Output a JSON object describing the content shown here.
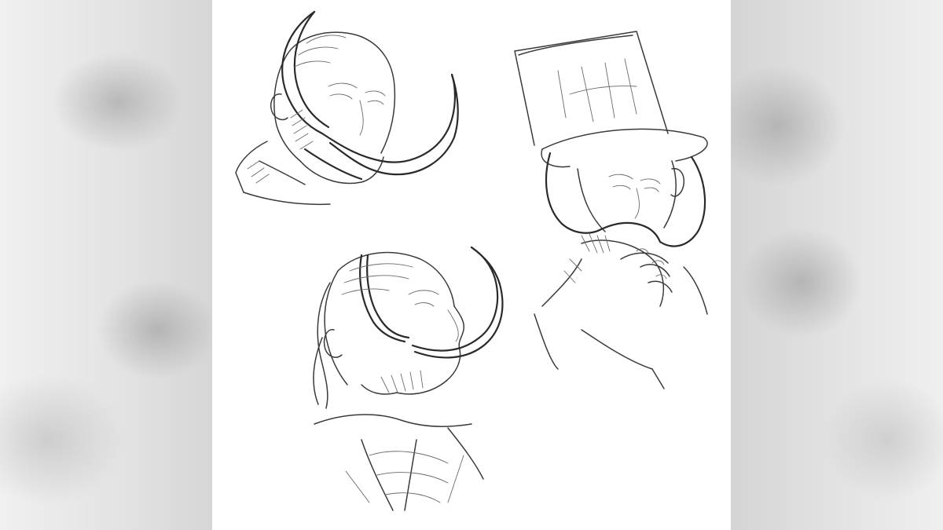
{
  "artwork": {
    "subject": "pencil-sketch-sheet",
    "colors": {
      "paper": "#ffffff",
      "pencil": "#3a3a3a",
      "blur_background": "#dcdcdc"
    }
  }
}
